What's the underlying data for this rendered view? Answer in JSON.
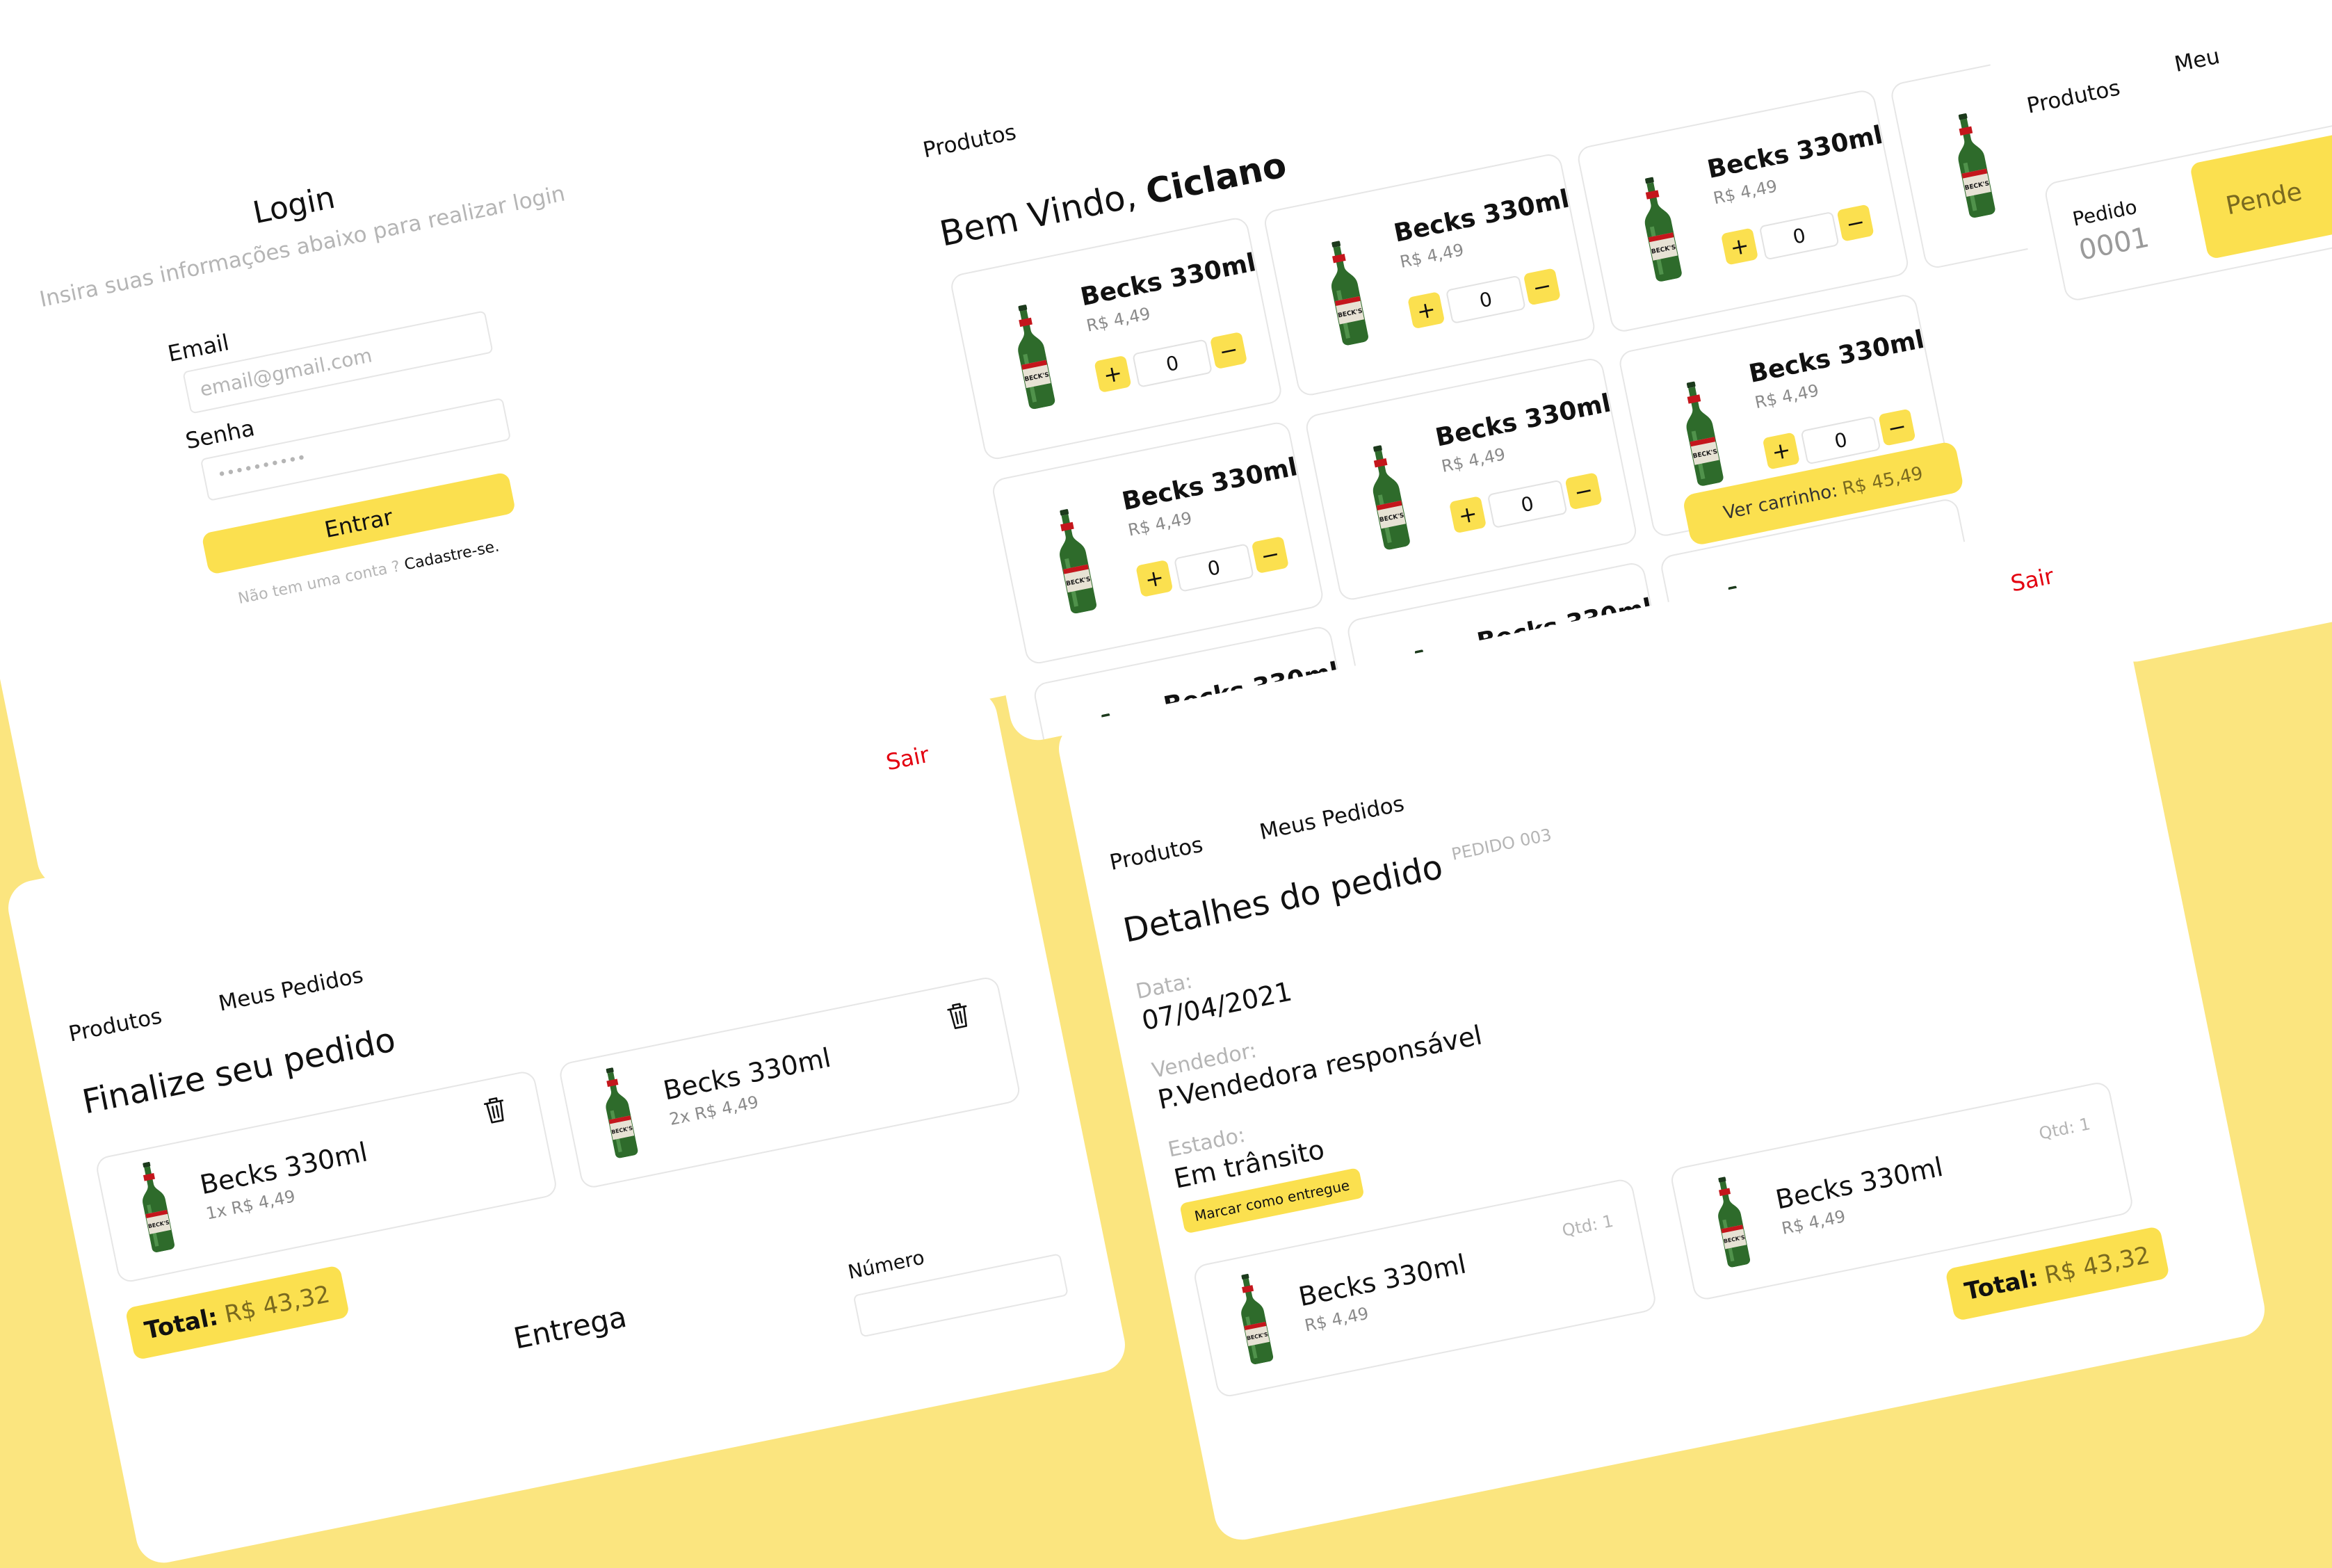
{
  "login": {
    "title": "Login",
    "subtitle": "Insira suas informações abaixo para realizar login",
    "email_label": "Email",
    "email_placeholder": "email@gmail.com",
    "password_label": "Senha",
    "password_value": "••••••••••",
    "submit_label": "Entrar",
    "no_account_text": "Não tem uma conta ?",
    "signup_link": "Cadastre-se."
  },
  "products": {
    "nav_products": "Produtos",
    "greeting_prefix": "Bem Vindo,",
    "user_name": "Ciclano",
    "item_name": "Becks 330ml",
    "item_price": "R$ 4,49",
    "plus": "+",
    "minus": "−",
    "qty_value": "0",
    "cart_button": "Ver carrinho:",
    "cart_total": "R$ 45,49"
  },
  "orders_list": {
    "nav_products": "Produtos",
    "nav_orders_partial": "Meu",
    "order_label": "Pedido",
    "order_number": "0001",
    "status_partial": "Pende"
  },
  "checkout": {
    "logout": "Sair",
    "nav_products": "Produtos",
    "nav_orders": "Meus Pedidos",
    "title": "Finalize seu pedido",
    "items": [
      {
        "name": "Becks 330ml",
        "detail": "1x R$ 4,49"
      },
      {
        "name": "Becks 330ml",
        "detail": "2x R$ 4,49"
      }
    ],
    "total_label": "Total:",
    "total_value": "R$ 43,32",
    "delivery_partial": "Entrega",
    "number_label": "Número"
  },
  "order_details": {
    "logout": "Sair",
    "nav_products": "Produtos",
    "nav_orders": "Meus Pedidos",
    "title": "Detalhes do pedido",
    "order_code": "PEDIDO 003",
    "date_label": "Data:",
    "date_value": "07/04/2021",
    "seller_label": "Vendedor:",
    "seller_value": "P.Vendedora responsável",
    "status_label": "Estado:",
    "status_value": "Em trânsito",
    "mark_delivered": "Marcar como entregue",
    "items": [
      {
        "name": "Becks 330ml",
        "price": "R$ 4,49",
        "qty": "Qtd: 1"
      },
      {
        "name": "Becks 330ml",
        "price": "R$ 4,49",
        "qty": "Qtd: 1"
      }
    ],
    "total_label": "Total:",
    "total_value": "R$ 43,32"
  },
  "colors": {
    "background": "#FBE57F",
    "accent": "#FBE04F",
    "danger": "#E3000F"
  }
}
